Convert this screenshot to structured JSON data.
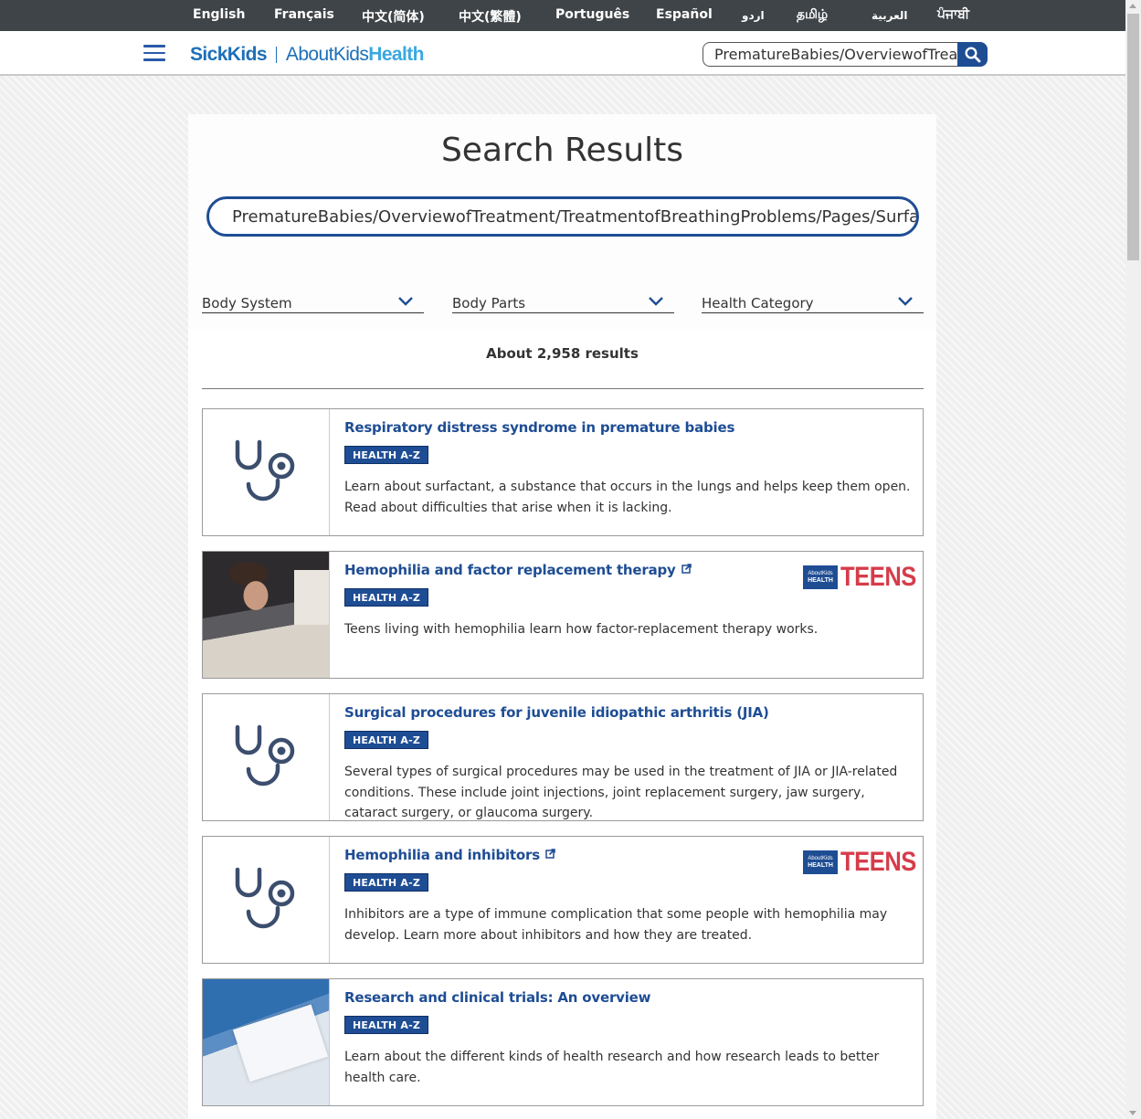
{
  "languages": [
    "English",
    "Français",
    "中文(简体)",
    "中文(繁體)",
    "Português",
    "Español",
    "اردو",
    "தமிழ்",
    "العربية",
    "ਪੰਜਾਬੀ"
  ],
  "header": {
    "logo_sick": "SickKids",
    "logo_about": "About",
    "logo_kids": "Kids",
    "logo_health": "Health",
    "search_value": "PrematureBabies/OverviewofTreatmentofBreathingProblems",
    "search_icon": "search-icon"
  },
  "page": {
    "title": "Search Results",
    "search_value": "PrematureBabies/OverviewofTreatment/TreatmentofBreathingProblems/Pages/Surfactant",
    "filters": [
      "Body System",
      "Body Parts",
      "Health Category"
    ],
    "results_count": "About 2,958 results"
  },
  "results": [
    {
      "title": "Respiratory distress syndrome in premature babies",
      "badge": "HEALTH A-Z",
      "description": "Learn about surfactant, a substance that occurs in the lungs and helps keep them open. Read about difficulties that arise when it is lacking.",
      "thumb": "stethoscope-icon",
      "external": false,
      "teens": false
    },
    {
      "title": "Hemophilia and factor replacement therapy",
      "badge": "HEALTH A-Z",
      "description": "Teens living with hemophilia learn how factor-replacement therapy works.",
      "thumb": "photo",
      "external": true,
      "teens": true
    },
    {
      "title": "Surgical procedures for juvenile idiopathic arthritis (JIA)",
      "badge": "HEALTH A-Z",
      "description": "Several types of surgical procedures may be used in the treatment of JIA or JIA-related conditions. These include joint injections, joint replacement surgery, jaw surgery, cataract surgery, or glaucoma surgery.",
      "thumb": "stethoscope-icon",
      "external": false,
      "teens": false
    },
    {
      "title": "Hemophilia and inhibitors",
      "badge": "HEALTH A-Z",
      "description": "Inhibitors are a type of immune complication that some people with hemophilia may develop. Learn more about inhibitors and how they are treated.",
      "thumb": "stethoscope-icon",
      "external": true,
      "teens": true
    },
    {
      "title": "Research and clinical trials: An overview",
      "badge": "HEALTH A-Z",
      "description": "Learn about the different kinds of health research and how research leads to better health care.",
      "thumb": "photo",
      "external": false,
      "teens": false
    }
  ],
  "teens_logo": {
    "box_line1": "AboutKids",
    "box_line2": "HEALTH",
    "text": "TEENS"
  },
  "colors": {
    "brand_blue": "#1e4d94",
    "teens_red": "#d63c4a",
    "lang_bar": "#3f4448"
  }
}
